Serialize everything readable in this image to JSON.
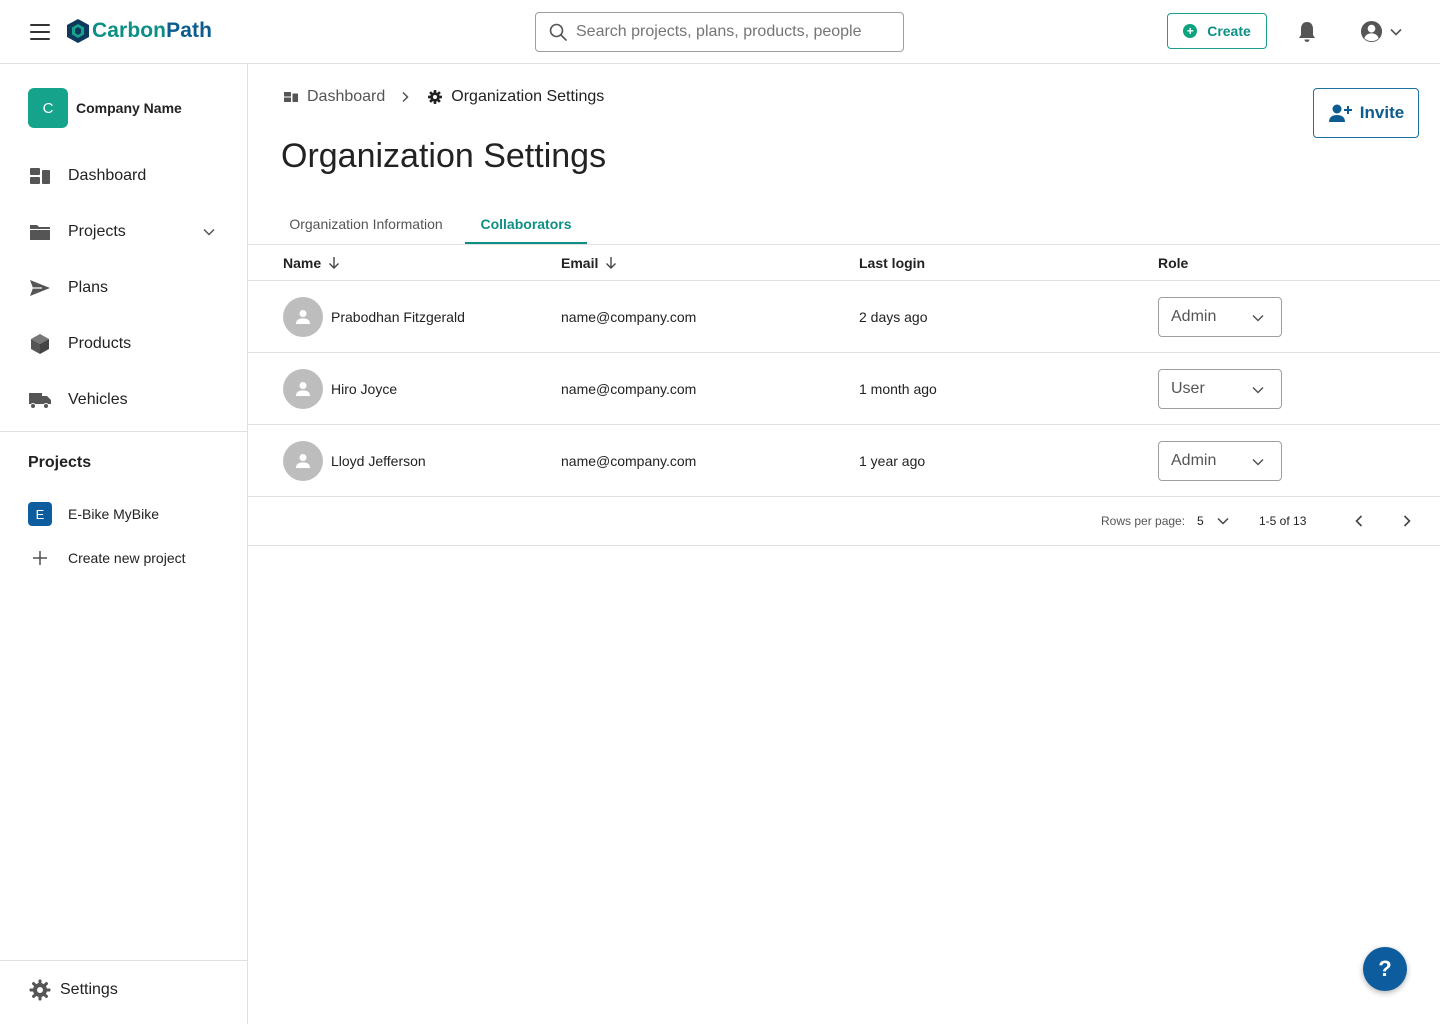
{
  "app": {
    "brand_part1": "Carbon",
    "brand_part2": "Path",
    "brand_color": "#0d8f86",
    "brand_color_secondary": "#0d5c8f"
  },
  "topbar": {
    "menu_icon": "hamburger-icon",
    "search_placeholder": "Search projects, plans, products, people",
    "create_label": "Create",
    "notification_icon": "bell-icon",
    "account_icon": "account-circle-icon"
  },
  "sidebar": {
    "company": {
      "initial": "C",
      "name": "Company Name"
    },
    "items": [
      {
        "label": "Dashboard",
        "icon": "dashboard-icon"
      },
      {
        "label": "Projects",
        "icon": "folder-icon",
        "expandable": true
      },
      {
        "label": "Plans",
        "icon": "send-icon"
      },
      {
        "label": "Products",
        "icon": "cube-icon"
      },
      {
        "label": "Vehicles",
        "icon": "truck-icon"
      }
    ],
    "projects_section_title": "Projects",
    "projects": [
      {
        "initial": "E",
        "label": "E-Bike MyBike"
      }
    ],
    "create_project_label": "Create new project",
    "settings_label": "Settings"
  },
  "breadcrumb": {
    "items": [
      {
        "label": "Dashboard",
        "icon": "dashboard-icon"
      },
      {
        "label": "Organization Settings",
        "icon": "gear-icon"
      }
    ]
  },
  "page": {
    "title": "Organization Settings",
    "invite_label": "Invite"
  },
  "tabs": [
    {
      "label": "Organization Information",
      "active": false
    },
    {
      "label": "Collaborators",
      "active": true
    }
  ],
  "table": {
    "columns": [
      {
        "label": "Name",
        "sortable": true
      },
      {
        "label": "Email",
        "sortable": true
      },
      {
        "label": "Last login",
        "sortable": false
      },
      {
        "label": "Role",
        "sortable": false
      }
    ],
    "rows": [
      {
        "name": "Prabodhan Fitzgerald",
        "email": "name@company.com",
        "last_login": "2 days ago",
        "role": "Admin"
      },
      {
        "name": "Hiro Joyce",
        "email": "name@company.com",
        "last_login": "1 month ago",
        "role": "User"
      },
      {
        "name": "Lloyd Jefferson",
        "email": "name@company.com",
        "last_login": "1 year ago",
        "role": "Admin"
      }
    ]
  },
  "pagination": {
    "rows_per_page_label": "Rows per page:",
    "rows_per_page": "5",
    "range": "1-5 of 13"
  },
  "help": {
    "label": "?"
  }
}
